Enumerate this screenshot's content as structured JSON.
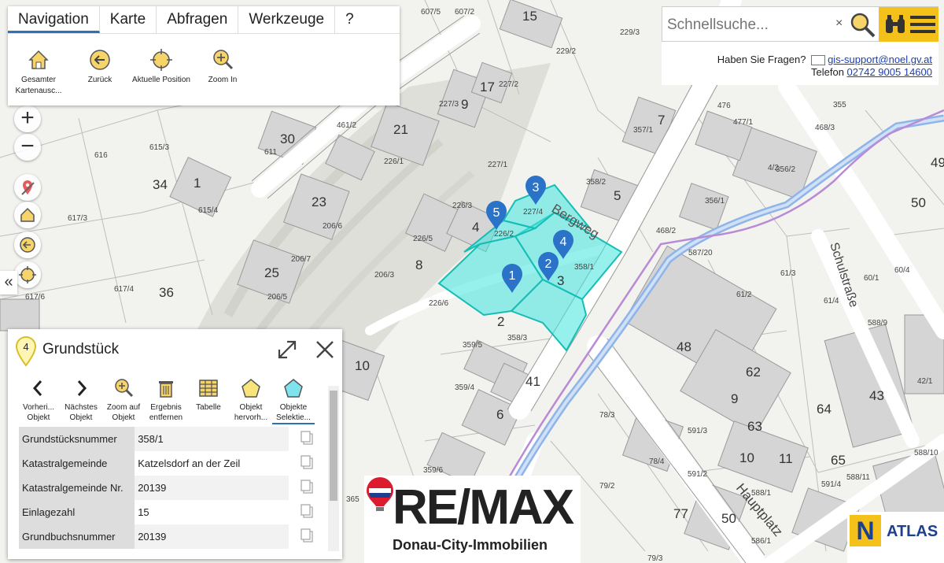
{
  "toolbar": {
    "tabs": [
      "Navigation",
      "Karte",
      "Abfragen",
      "Werkzeuge",
      "?"
    ],
    "tools": [
      {
        "icon": "home-icon",
        "label": "Gesamter Kartenausc..."
      },
      {
        "icon": "back-icon",
        "label": "Zurück"
      },
      {
        "icon": "locate-icon",
        "label": "Aktuelle Position"
      },
      {
        "icon": "zoom-in-icon",
        "label": "Zoom In"
      }
    ]
  },
  "search": {
    "placeholder": "Schnellsuche...",
    "clear": "×",
    "help_question": "Haben Sie Fragen?",
    "email": "gis-support@noel.gv.at",
    "phone_label": "Telefon",
    "phone": "02742 9005 14600"
  },
  "map": {
    "parcel_labels": [
      "607/5",
      "607/2",
      "15",
      "229/3",
      "229/2",
      "227/2",
      "227/3",
      "17",
      "9",
      "21",
      "461/2",
      "226/1",
      "357/1",
      "7",
      "30",
      "615/3",
      "611",
      "616",
      "34",
      "1",
      "615/4",
      "227/1",
      "358/2",
      "5",
      "23",
      "206/6",
      "226/3",
      "4",
      "227/4",
      "226/2",
      "226/5",
      "617/3",
      "206/7",
      "8",
      "206/3",
      "25",
      "206/5",
      "617/4",
      "36",
      "617/6",
      "226/6",
      "358/1",
      "3",
      "2",
      "358/3",
      "359/5",
      "10",
      "41",
      "359/4",
      "6",
      "359/6",
      "365",
      "355",
      "476",
      "477/1",
      "468/3",
      "4/2",
      "356/2",
      "356/1",
      "468/2",
      "587/20",
      "61/3",
      "61/2",
      "61/4",
      "60/1",
      "60/4",
      "50",
      "49",
      "48",
      "62",
      "63",
      "64",
      "9",
      "78/3",
      "78/4",
      "591/3",
      "591/2",
      "10",
      "11",
      "79/2",
      "77",
      "50",
      "588/1",
      "588/11",
      "591/4",
      "588/10",
      "65",
      "42/1",
      "43",
      "588/9",
      "586/1",
      "79/3"
    ],
    "street_labels": [
      "Bergweg",
      "Schulstraße",
      "Hauptplatz"
    ],
    "markers": [
      "1",
      "2",
      "3",
      "4",
      "5"
    ],
    "zoom_in": "+",
    "zoom_out": "−",
    "collapse": "«"
  },
  "info": {
    "badge": "4",
    "title": "Grundstück",
    "tools": [
      {
        "icon": "chevron-left-icon",
        "label": "Vorheri... Objekt"
      },
      {
        "icon": "chevron-right-icon",
        "label": "Nächstes Objekt"
      },
      {
        "icon": "zoom-to-object-icon",
        "label": "Zoom auf Objekt"
      },
      {
        "icon": "trash-icon",
        "label": "Ergebnis entfernen"
      },
      {
        "icon": "table-icon",
        "label": "Tabelle"
      },
      {
        "icon": "highlight-icon",
        "label": "Objekt hervorh..."
      },
      {
        "icon": "select-objects-icon",
        "label": "Objekte Selektie..."
      }
    ],
    "rows": [
      {
        "key": "Grundstücksnummer",
        "value": "358/1"
      },
      {
        "key": "Katastralgemeinde",
        "value": "Katzelsdorf an der Zeil"
      },
      {
        "key": "Katastralgemeinde Nr.",
        "value": "20139"
      },
      {
        "key": "Einlagezahl",
        "value": "15"
      },
      {
        "key": "Grundbuchsnummer",
        "value": "20139"
      }
    ]
  },
  "logos": {
    "remax_word": "RE/MAX",
    "remax_sub": "Donau-City-Immobilien",
    "atlas_word": "ATLAS",
    "atlas_mark": "N"
  },
  "colors": {
    "accent_tab": "#2a73b8",
    "selection_fill": "#3fe6df",
    "marker": "#2a73c8",
    "menu_yellow": "#f3c11a",
    "stream": "#8fb4e8",
    "boundary": "#b98ad6"
  }
}
